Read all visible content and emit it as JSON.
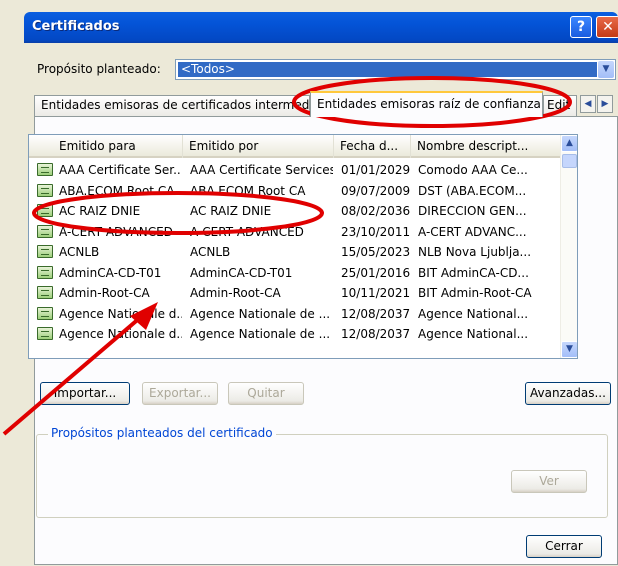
{
  "window": {
    "title": "Certificados"
  },
  "purpose": {
    "label": "Propósito planteado:",
    "selected": "<Todos>"
  },
  "tabs": [
    {
      "label": "Entidades emisoras de certificados intermedias"
    },
    {
      "label": "Entidades emisoras raíz de confianza"
    },
    {
      "label": "Edit"
    }
  ],
  "list": {
    "columns": [
      "Emitido para",
      "Emitido por",
      "Fecha d...",
      "Nombre descript..."
    ],
    "rows": [
      {
        "issued_to": "AAA Certificate Ser...",
        "issued_by": "AAA Certificate Services",
        "date": "01/01/2029",
        "name": "Comodo AAA Ce..."
      },
      {
        "issued_to": "ABA.ECOM Root CA",
        "issued_by": "ABA.ECOM Root CA",
        "date": "09/07/2009",
        "name": "DST (ABA.ECOM..."
      },
      {
        "issued_to": "AC RAIZ DNIE",
        "issued_by": "AC RAIZ DNIE",
        "date": "08/02/2036",
        "name": "DIRECCION GEN..."
      },
      {
        "issued_to": "A-CERT ADVANCED",
        "issued_by": "A-CERT ADVANCED",
        "date": "23/10/2011",
        "name": "A-CERT ADVANC..."
      },
      {
        "issued_to": "ACNLB",
        "issued_by": "ACNLB",
        "date": "15/05/2023",
        "name": "NLB Nova Ljublja..."
      },
      {
        "issued_to": "AdminCA-CD-T01",
        "issued_by": "AdminCA-CD-T01",
        "date": "25/01/2016",
        "name": "BIT AdminCA-CD..."
      },
      {
        "issued_to": "Admin-Root-CA",
        "issued_by": "Admin-Root-CA",
        "date": "10/11/2021",
        "name": "BIT Admin-Root-CA"
      },
      {
        "issued_to": "Agence Nationale d...",
        "issued_by": "Agence Nationale de ...",
        "date": "12/08/2037",
        "name": "Agence National..."
      },
      {
        "issued_to": "Agence Nationale d...",
        "issued_by": "Agence Nationale de ...",
        "date": "12/08/2037",
        "name": "Agence National..."
      }
    ]
  },
  "buttons": {
    "import": "Importar...",
    "export": "Exportar...",
    "remove": "Quitar",
    "advanced": "Avanzadas...",
    "view": "Ver",
    "close": "Cerrar"
  },
  "group": {
    "legend": "Propósitos planteados del certificado"
  },
  "icons": {
    "help": "help-icon",
    "close": "close-icon",
    "dropdown": "chevron-down-icon",
    "certificate": "certificate-icon"
  },
  "annotation_color": "#e00000"
}
